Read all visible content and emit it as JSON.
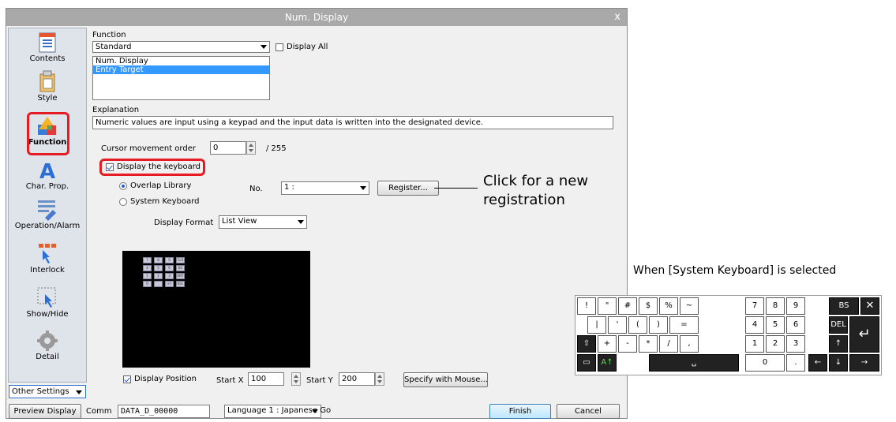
{
  "window": {
    "title": "Num. Display",
    "close_glyph": "x"
  },
  "sidebar": {
    "items": [
      {
        "label": "Contents",
        "icon": "contents-icon"
      },
      {
        "label": "Style",
        "icon": "style-icon"
      },
      {
        "label": "Function",
        "icon": "function-icon",
        "selected": true
      },
      {
        "label": "Char. Prop.",
        "icon": "char-prop-icon"
      },
      {
        "label": "Operation/Alarm",
        "icon": "operation-alarm-icon"
      },
      {
        "label": "Interlock",
        "icon": "interlock-icon"
      },
      {
        "label": "Show/Hide",
        "icon": "show-hide-icon"
      },
      {
        "label": "Detail",
        "icon": "detail-icon"
      }
    ],
    "other_settings": "Other Settings"
  },
  "function": {
    "label": "Function",
    "selected": "Standard",
    "display_all_label": "Display All",
    "display_all_checked": false,
    "list": [
      "Num. Display",
      "Entry Target"
    ],
    "list_selected": "Entry Target"
  },
  "explanation": {
    "label": "Explanation",
    "text": "Numeric values are input using a keypad and the input data is written into the designated device."
  },
  "cursor": {
    "label": "Cursor movement order",
    "value": "0",
    "max": "/ 255"
  },
  "keyboard": {
    "display_label": "Display the keyboard",
    "display_checked": true,
    "overlap_label": "Overlap Library",
    "system_label": "System Keyboard",
    "selected": "Overlap Library",
    "no_label": "No.",
    "no_value": "1 :",
    "register_label": "Register...",
    "format_label": "Display Format",
    "format_value": "List View"
  },
  "preview_keys": [
    "7",
    "8",
    "9",
    "CLR",
    "4",
    "5",
    "6",
    "BS",
    "1",
    "2",
    "3",
    "ENT",
    "0",
    ".",
    "+/-",
    "ESC"
  ],
  "position": {
    "label": "Display Position",
    "checked": true,
    "startx_label": "Start X",
    "startx": "100",
    "starty_label": "Start Y",
    "starty": "200",
    "mouse_label": "Specify with Mouse..."
  },
  "bottom": {
    "preview_label": "Preview Display",
    "comm_label": "Comm",
    "comm_value": "DATA_D_00000",
    "language": "Language 1 : Japanese Go",
    "finish": "Finish",
    "cancel": "Cancel"
  },
  "annotations": {
    "click_line1": "Click for a new",
    "click_line2": "registration",
    "system_kb_caption": "When [System Keyboard] is selected"
  },
  "system_keyboard": {
    "row1": [
      "!",
      "\"",
      "#",
      "$",
      "%",
      "~",
      "7",
      "8",
      "9",
      "BS",
      "✕"
    ],
    "row2": [
      "|",
      "'",
      "(",
      ")",
      "=",
      "4",
      "5",
      "6",
      "DEL",
      "↵"
    ],
    "row3": [
      "⇧",
      "+",
      "-",
      "*",
      "/",
      ",",
      "1",
      "2",
      "3",
      "↑"
    ],
    "row4": [
      "▭",
      "A↑",
      "␣",
      "0",
      ".",
      "←",
      "↓",
      "→"
    ]
  },
  "colors": {
    "highlight": "#e51c23",
    "selection": "#3399ff",
    "titlebar": "#a9a9a9"
  }
}
